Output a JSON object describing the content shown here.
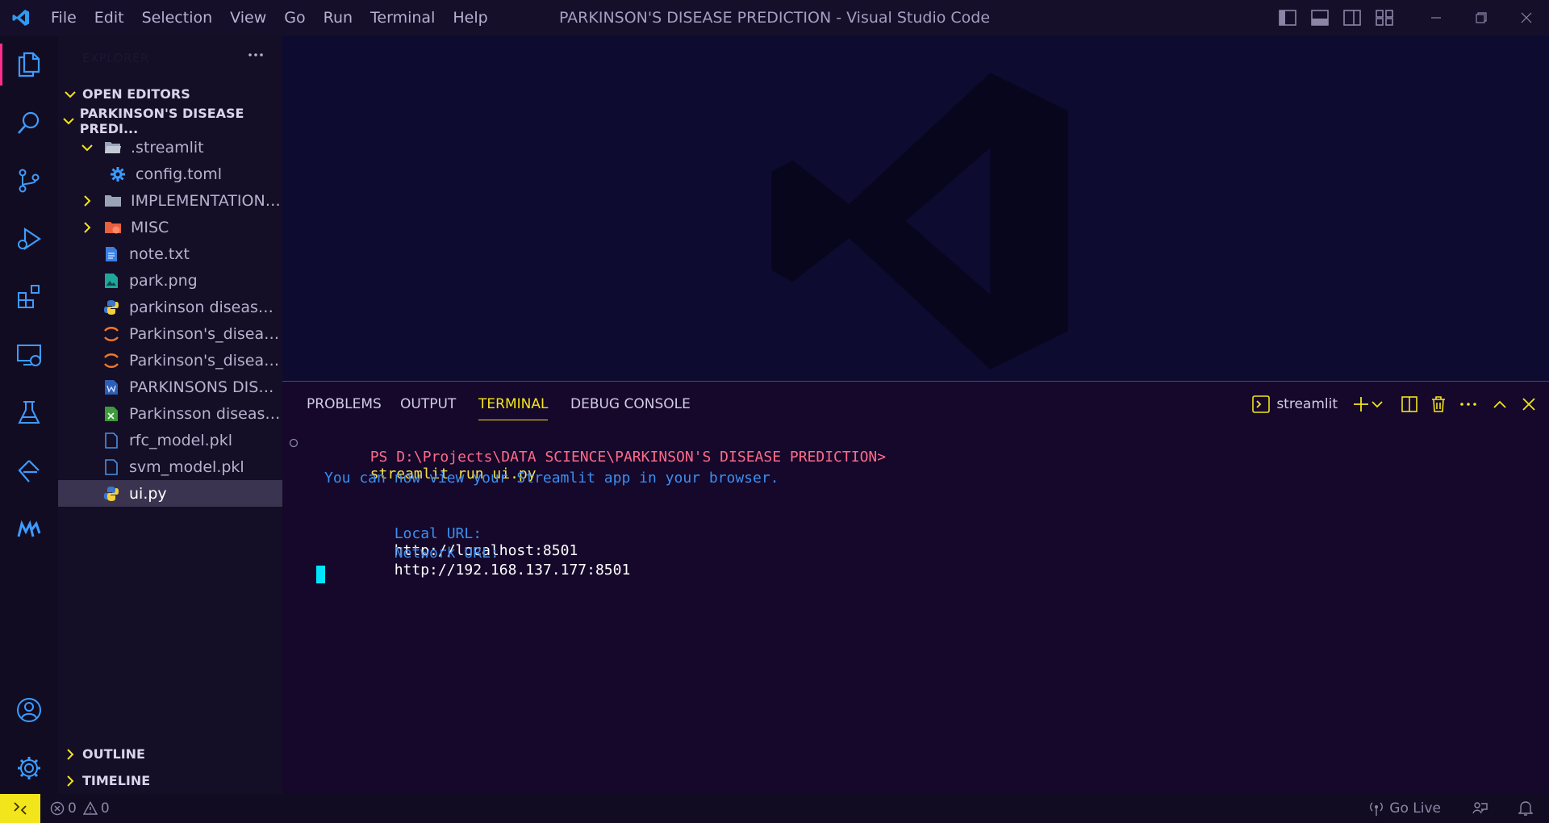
{
  "window": {
    "title": "PARKINSON'S DISEASE PREDICTION - Visual Studio Code"
  },
  "menu": [
    "File",
    "Edit",
    "Selection",
    "View",
    "Go",
    "Run",
    "Terminal",
    "Help"
  ],
  "sidebar": {
    "header": "EXPLORER",
    "sections": {
      "open_editors": "OPEN EDITORS",
      "project": "PARKINSON'S DISEASE PREDI...",
      "outline": "OUTLINE",
      "timeline": "TIMELINE"
    },
    "tree": [
      {
        "label": ".streamlit",
        "icon": "folder-open-icon"
      },
      {
        "label": "config.toml",
        "icon": "gear-file-icon"
      },
      {
        "label": "IMPLEMENTATION ...",
        "icon": "folder-icon"
      },
      {
        "label": "MISC",
        "icon": "misc-folder-icon"
      },
      {
        "label": "note.txt",
        "icon": "text-file-icon"
      },
      {
        "label": "park.png",
        "icon": "image-file-icon"
      },
      {
        "label": "parkinson disease us...",
        "icon": "python-file-icon"
      },
      {
        "label": "Parkinson's_disease_...",
        "icon": "jupyter-file-icon"
      },
      {
        "label": "Parkinson's_disease_...",
        "icon": "jupyter-file-icon"
      },
      {
        "label": "PARKINSONS DISEA...",
        "icon": "word-file-icon"
      },
      {
        "label": "Parkinsson disease.csv",
        "icon": "csv-file-icon"
      },
      {
        "label": "rfc_model.pkl",
        "icon": "file-icon"
      },
      {
        "label": "svm_model.pkl",
        "icon": "file-icon"
      },
      {
        "label": "ui.py",
        "icon": "python-file-icon"
      }
    ]
  },
  "panel": {
    "tabs": [
      "PROBLEMS",
      "OUTPUT",
      "TERMINAL",
      "DEBUG CONSOLE"
    ],
    "active_tab": "TERMINAL",
    "terminal_name": "streamlit",
    "terminal": {
      "prompt": "PS D:\\Projects\\DATA SCIENCE\\PARKINSON'S DISEASE PREDICTION>",
      "command": "streamlit run ui.py",
      "info": "You can now view your Streamlit app in your browser.",
      "local_label": "Local URL:",
      "local_url": "http://localhost:8501",
      "network_label": "Network URL:",
      "network_url": "http://192.168.137.177:8501"
    }
  },
  "status": {
    "errors": "0",
    "warnings": "0",
    "go_live": "Go Live"
  },
  "colors": {
    "accent_yellow": "#f3e51b",
    "active_indicator": "#ff2e8c",
    "cursor": "#00e5ff"
  }
}
